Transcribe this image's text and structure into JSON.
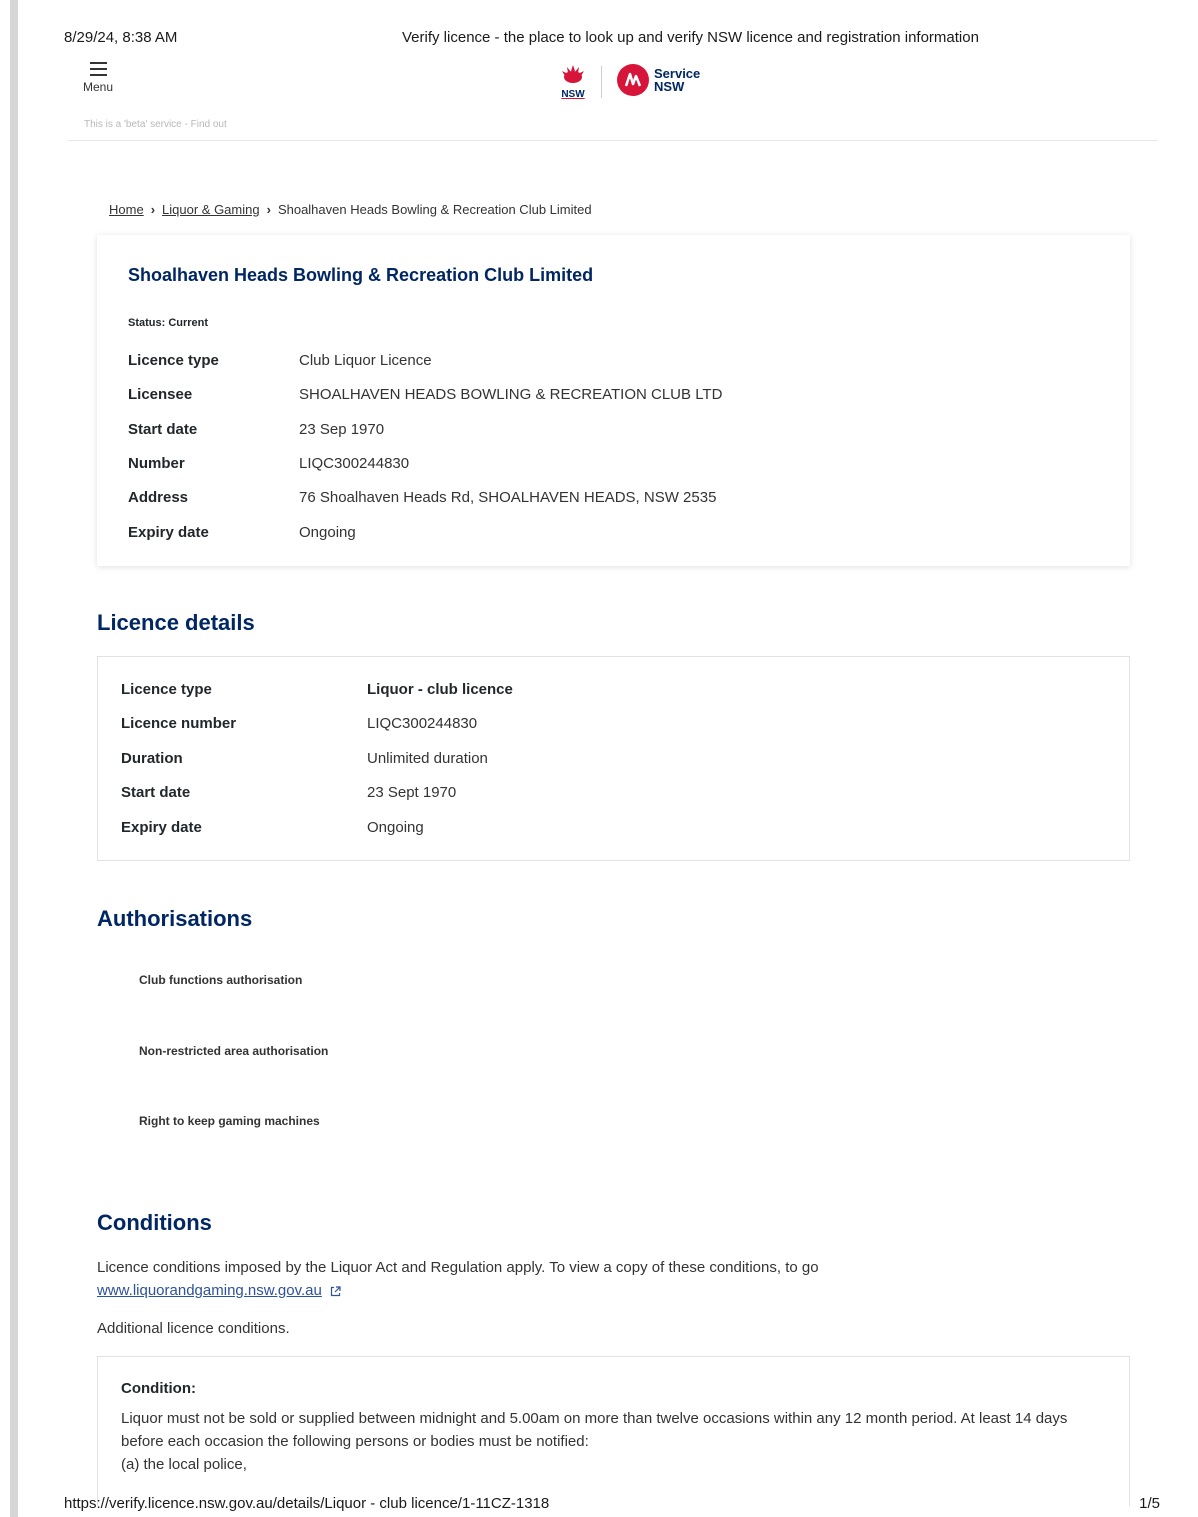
{
  "print_header": {
    "date": "8/29/24, 8:38 AM",
    "title": "Verify licence - the place to look up and verify NSW licence and registration information"
  },
  "header": {
    "menu_label": "Menu",
    "logo_nsw_text": "NSW",
    "logo_service_line1": "Service",
    "logo_service_line2": "NSW",
    "beta_text": "This is a 'beta' service - Find out"
  },
  "breadcrumb": {
    "home": "Home",
    "category": "Liquor & Gaming",
    "current": "Shoalhaven Heads Bowling & Recreation Club Limited"
  },
  "summary": {
    "title": "Shoalhaven Heads Bowling & Recreation Club Limited",
    "status": "Status: Current",
    "rows": [
      {
        "label": "Licence type",
        "value": "Club Liquor Licence"
      },
      {
        "label": "Licensee",
        "value": "SHOALHAVEN HEADS BOWLING & RECREATION CLUB LTD"
      },
      {
        "label": "Start date",
        "value": "23 Sep 1970"
      },
      {
        "label": "Number",
        "value": "LIQC300244830"
      },
      {
        "label": "Address",
        "value": "76 Shoalhaven Heads Rd, SHOALHAVEN HEADS, NSW 2535"
      },
      {
        "label": "Expiry date",
        "value": "Ongoing"
      }
    ]
  },
  "licence_details": {
    "heading": "Licence details",
    "rows": [
      {
        "label": "Licence type",
        "value": "Liquor - club licence"
      },
      {
        "label": "Licence number",
        "value": "LIQC300244830"
      },
      {
        "label": "Duration",
        "value": "Unlimited duration"
      },
      {
        "label": "Start date",
        "value": "23 Sept 1970"
      },
      {
        "label": "Expiry date",
        "value": "Ongoing"
      }
    ]
  },
  "authorisations": {
    "heading": "Authorisations",
    "items": [
      "Club functions authorisation",
      "Non-restricted area authorisation",
      "Right to keep gaming machines"
    ]
  },
  "conditions": {
    "heading": "Conditions",
    "intro": "Licence conditions imposed by the Liquor Act and Regulation apply. To view a copy of these conditions, to go",
    "link": "www.liquorandgaming.nsw.gov.au",
    "additional": "Additional licence conditions.",
    "condition_title": "Condition:",
    "condition_text": "Liquor must not be sold or supplied between midnight and 5.00am on more than twelve occasions within any 12 month period. At least 14 days before each occasion the following persons or bodies must be notified:",
    "condition_item": "(a) the local police,"
  },
  "print_footer": {
    "url": "https://verify.licence.nsw.gov.au/details/Liquor - club licence/1-11CZ-1318",
    "page": "1/5"
  },
  "colors": {
    "brand_navy": "#002664",
    "brand_red": "#d7153a",
    "link_blue": "#2e5299"
  }
}
